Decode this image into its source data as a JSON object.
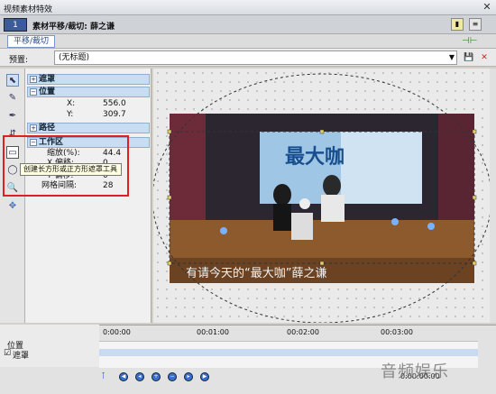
{
  "window": {
    "title": "视频素材特效"
  },
  "header": {
    "number": "1",
    "title": "素材平移/裁切: 薛之谦"
  },
  "tabs": [
    {
      "label": "平移/裁切"
    }
  ],
  "preset": {
    "label": "预置:",
    "value": "(无标题)"
  },
  "properties": {
    "sections": [
      {
        "label": "遮罩",
        "sign": "+"
      },
      {
        "label": "位置",
        "sign": "−"
      },
      {
        "label": "路径",
        "sign": "+"
      },
      {
        "label": "工作区",
        "sign": "−"
      }
    ],
    "position": [
      {
        "key": "X:",
        "value": "556.0"
      },
      {
        "key": "Y:",
        "value": "309.7"
      }
    ],
    "workspace": [
      {
        "key": "缩放(%):",
        "value": "44.4"
      },
      {
        "key": "X 偏移:",
        "value": "0"
      },
      {
        "key": "Y 偏移:",
        "value": "0"
      },
      {
        "key": "网格间隔:",
        "value": "28"
      }
    ]
  },
  "tooltip": "创建长方形或正方形遮罩工具",
  "video": {
    "subtitle": "有请今天的“最大咖”薛之谦",
    "banner": "最大咖"
  },
  "timeline": {
    "rows": [
      {
        "label": "位置"
      },
      {
        "label": "遮罩"
      }
    ],
    "ticks": [
      "0:00:00",
      "00:01:00",
      "00:02:00",
      "00:03:00"
    ],
    "timecode": "0:00:00:00"
  },
  "watermark": "音频娱乐",
  "colors": {
    "accent": "#3b5b9a",
    "highlight": "#e02020",
    "keyframe": "#3a6fd0"
  }
}
